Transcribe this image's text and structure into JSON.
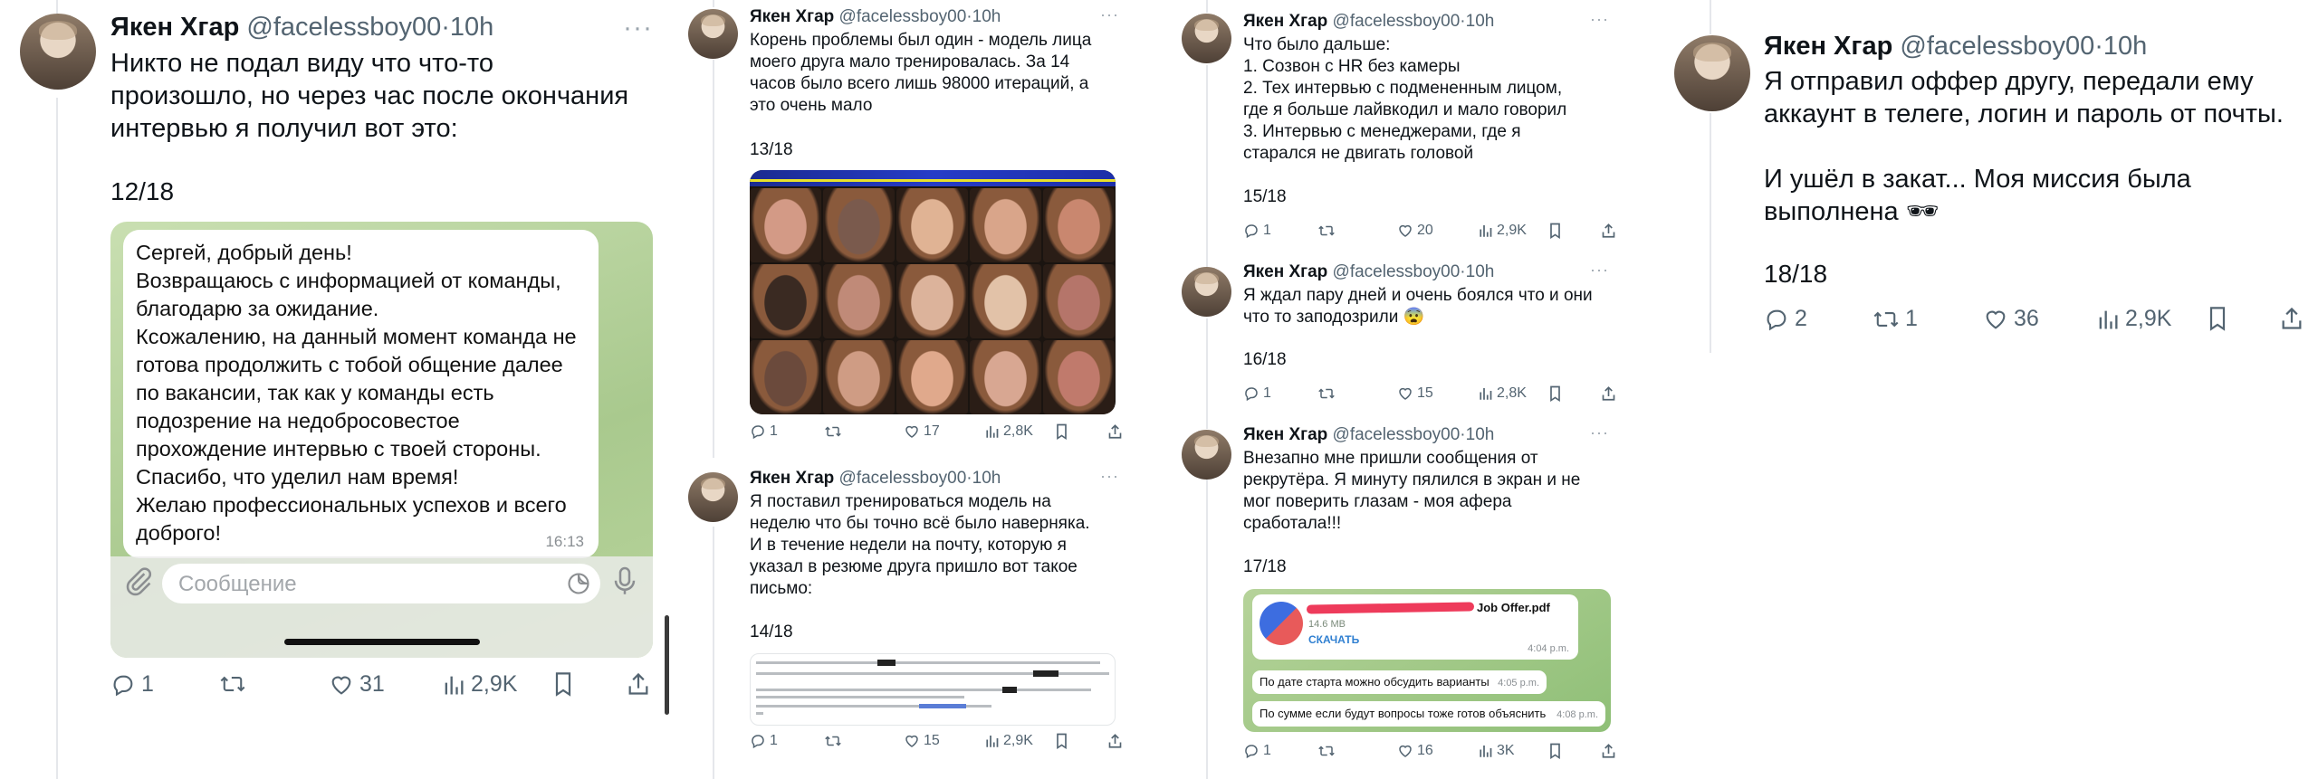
{
  "author": {
    "name": "Якен Хгар",
    "handle": "@facelessboy00",
    "time": "10h"
  },
  "col1": {
    "text": "Никто не подал виду что что-то\nпроизошло, но через час после окончания\nинтервью я получил вот это:",
    "count": "12/18",
    "message": "Сергей, добрый день!\nВозвращаюсь с информацией от команды,\nблагодарю за ожидание.\nКсожалению, на данный момент команда не\nготова продолжить с тобой общение далее\nпо вакансии, так как у команды есть\nподозрение на недобросовестое\nпрохождение интервью с твоей стороны.\nСпасибо, что уделил нам время!\nЖелаю профессиональных успехов и всего\nдоброго!",
    "message_time": "16:13",
    "composer_placeholder": "Сообщение",
    "stats": {
      "replies": "1",
      "likes": "31",
      "views": "2,9K"
    }
  },
  "col2": {
    "t13": {
      "text": "Корень проблемы был один - модель лица\nмоего друга мало тренировалась. За 14\nчасов было всего лишь 98000 итераций, а\nэто очень мало",
      "count": "13/18",
      "stats": {
        "replies": "1",
        "likes": "17",
        "views": "2,8K"
      }
    },
    "t14": {
      "text": "Я поставил тренироваться модель на\nнеделю что бы точно всё было наверняка.\nИ в течение недели на почту, которую я\nуказал в резюме друга пришло вот такое\nписьмо:",
      "count": "14/18",
      "stats": {
        "replies": "1",
        "likes": "15",
        "views": "2,9K"
      }
    }
  },
  "col3": {
    "t15": {
      "text": "Что было дальше:\n1. Созвон с HR без камеры\n2. Тех интервью с подмененным лицом,\nгде я больше лайвкодил и мало говорил\n3. Интервью с менеджерами, где я\nстарался не двигать головой",
      "count": "15/18",
      "stats": {
        "replies": "1",
        "likes": "20",
        "views": "2,9K"
      }
    },
    "t16": {
      "text": "Я ждал пару дней и очень боялся что и они\nчто то заподозрили 😨",
      "count": "16/18",
      "stats": {
        "replies": "1",
        "likes": "15",
        "views": "2,8K"
      }
    },
    "t17": {
      "text": "Внезапно мне пришли сообщения от\nрекрутёра. Я минуту пялился в экран и не\nмог поверить глазам - моя афера\nсработала!!!",
      "count": "17/18",
      "stats": {
        "replies": "1",
        "likes": "16",
        "views": "3K"
      },
      "file_name": "Job Offer.pdf",
      "file_size": "14.6 MB",
      "file_action": "СКАЧАТЬ",
      "file_time": "4:04 p.m.",
      "msg1": "По дате старта можно обсудить варианты",
      "msg1_time": "4:05 p.m.",
      "msg2": "По сумме если будут вопросы тоже готов объяснить",
      "msg2_time": "4:08 p.m."
    }
  },
  "col4": {
    "text": "Я отправил оффер другу, передали ему\nаккаунт в телеге, логин и пароль от почты.\n\nИ ушёл в закат... Моя миссия была\nвыполнена 🕶",
    "count": "18/18",
    "stats": {
      "replies": "2",
      "retweets": "1",
      "likes": "36",
      "views": "2,9K"
    }
  },
  "icons": {
    "reply": "reply-icon",
    "retweet": "retweet-icon",
    "like": "heart-icon",
    "views": "views-icon",
    "bookmark": "bookmark-icon",
    "share": "share-icon",
    "more": "more-icon"
  }
}
